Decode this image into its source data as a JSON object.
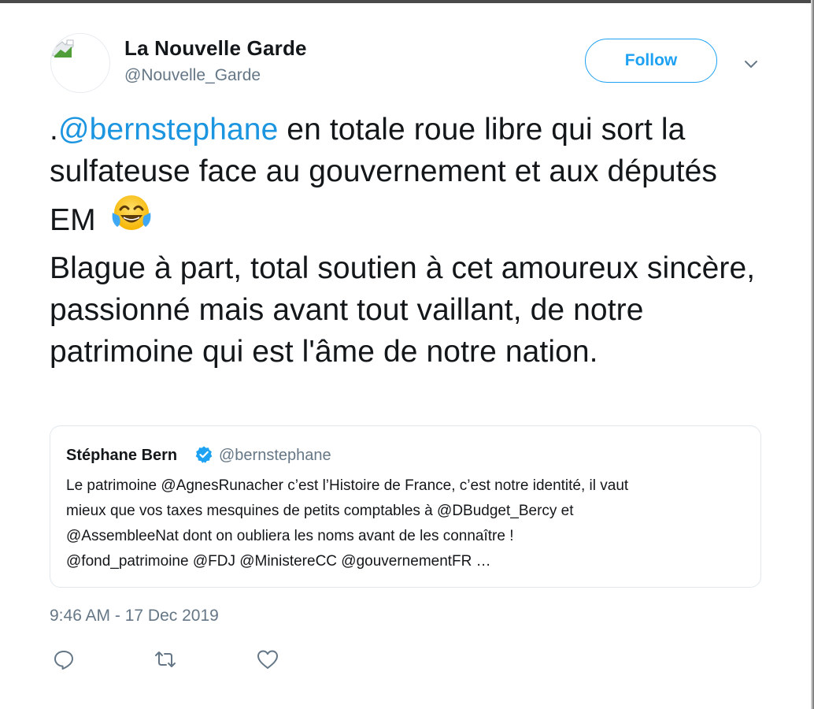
{
  "author": {
    "name": "La Nouvelle Garde",
    "handle": "@Nouvelle_Garde",
    "avatar_icon": "broken-image-icon"
  },
  "header": {
    "follow_label": "Follow",
    "menu_icon": "chevron-down-icon"
  },
  "tweet": {
    "prefix": ".",
    "mention": "@bernstephane",
    "text_1": " en totale roue libre qui sort la sulfateuse face au gouvernement et aux députés EM",
    "emoji": "face-with-tears-of-joy",
    "text_2": "Blague à part, total soutien à cet amoureux sincère, passionné mais avant tout vaillant, de notre patrimoine qui est l'âme de notre nation."
  },
  "quoted_tweet": {
    "name": "Stéphane Bern",
    "verified": true,
    "handle": "@bernstephane",
    "lines": [
      "Le patrimoine @AgnesRunacher c’est l’Histoire de France, c’est notre identité, il vaut",
      "mieux que vos taxes mesquines de petits comptables à @DBudget_Bercy et",
      "@AssembleeNat dont on oubliera les noms avant de les connaître !",
      "@fond_patrimoine @FDJ @MinistereCC @gouvernementFR …"
    ]
  },
  "timestamp": "9:46 AM - 17 Dec 2019",
  "actions": [
    "reply-icon",
    "retweet-icon",
    "like-icon"
  ],
  "colors": {
    "accent": "#1da1f2",
    "mention": "#1b95e0",
    "text": "#14171a",
    "secondary": "#657786",
    "border": "#e1e8ed"
  }
}
